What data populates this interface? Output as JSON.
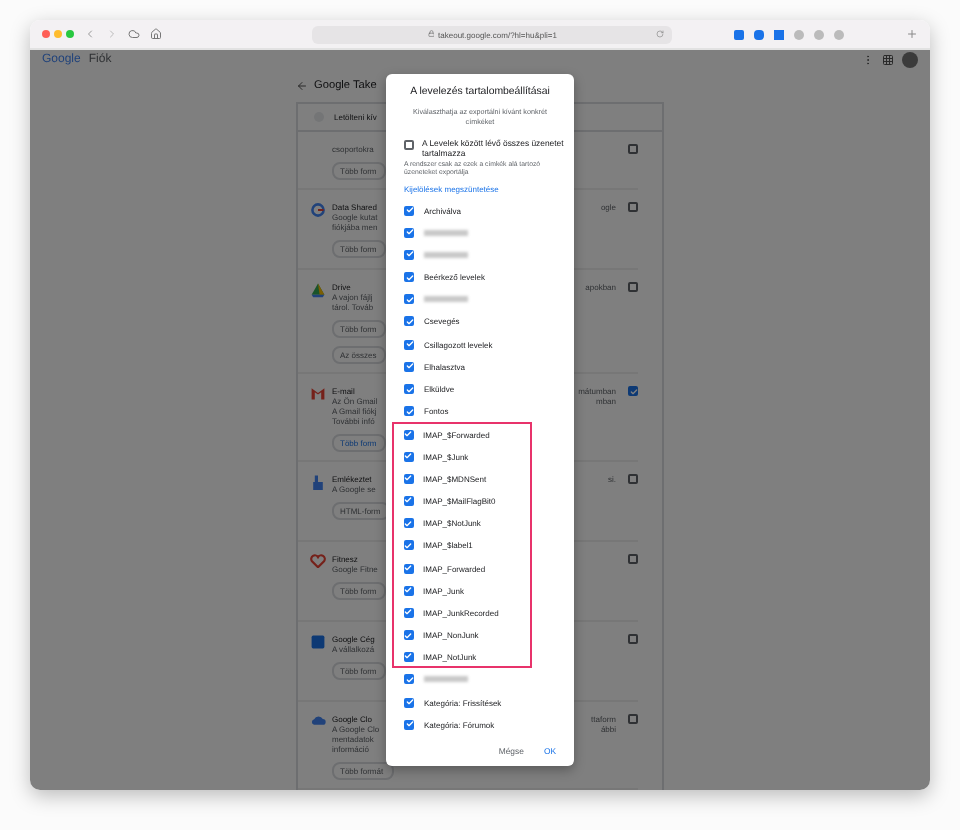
{
  "browser": {
    "url": "takeout.google.com/?hl=hu&pli=1"
  },
  "page": {
    "brand": "Google",
    "product": "Fiók",
    "title": "Google Take",
    "panel_header": "Letölteni kív",
    "services": [
      {
        "lines": [
          "csoportokra"
        ],
        "chip": "Több form",
        "checked": false
      },
      {
        "name": "Data Shared",
        "lines": [
          "Google kutat",
          "fiókjába men"
        ],
        "chip": "Több form",
        "tail": [
          "ogle"
        ],
        "checked": false
      },
      {
        "name": "Drive",
        "lines": [
          "A vajon fájlj",
          "tárol. Továb"
        ],
        "chip": "Több form",
        "chip2": "Az összes",
        "tail": [
          "apokban"
        ],
        "checked": false
      },
      {
        "name": "E-mail",
        "lines": [
          "Az Ön Gmail",
          "A Gmail fiókj",
          "További infó"
        ],
        "chip": "Több form",
        "tail": [
          "mátumban",
          "mban"
        ],
        "checked": true
      },
      {
        "name": "Emlékeztet",
        "lines": [
          "A Google se"
        ],
        "chip": "HTML-form",
        "tail": [
          "si."
        ],
        "checked": false
      },
      {
        "name": "Fitnesz",
        "lines": [
          "Google Fitne"
        ],
        "chip": "Több form",
        "checked": false
      },
      {
        "name": "Google Cég",
        "lines": [
          "A vállalkozá"
        ],
        "chip": "Több form",
        "checked": false
      },
      {
        "name": "Google Clo",
        "lines": [
          "A Google Clo",
          "mentadatok",
          "információ"
        ],
        "chip": "Több formát",
        "tail": [
          "ttaform",
          "ábbi"
        ],
        "checked": false
      }
    ]
  },
  "dialog": {
    "title": "A levelezés tartalombeállításai",
    "subtitle": "Kiválaszthatja az exportálni kívánt konkrét címkéket",
    "include_all": {
      "label": "A Levelek között lévő összes üzenetet tartalmazza",
      "hint": "A rendszer csak az ezek a címkék alá tartozó üzeneteket exportálja",
      "checked": false
    },
    "clear_link": "Kijelölések megszüntetése",
    "labels": [
      {
        "kind": "text",
        "label": "Archiválva",
        "checked": true,
        "highlighted": false
      },
      {
        "kind": "redacted",
        "checked": true,
        "highlighted": false
      },
      {
        "kind": "redacted",
        "checked": true,
        "highlighted": false
      },
      {
        "kind": "text",
        "label": "Beérkező levelek",
        "checked": true,
        "highlighted": false
      },
      {
        "kind": "redacted",
        "checked": true,
        "highlighted": false
      },
      {
        "kind": "text",
        "label": "Csevegés",
        "checked": true,
        "highlighted": false
      },
      {
        "kind": "text",
        "label": "Csillagozott levelek",
        "checked": true,
        "highlighted": false
      },
      {
        "kind": "text",
        "label": "Elhalasztva",
        "checked": true,
        "highlighted": false
      },
      {
        "kind": "text",
        "label": "Elküldve",
        "checked": true,
        "highlighted": false
      },
      {
        "kind": "text",
        "label": "Fontos",
        "checked": true,
        "highlighted": false
      },
      {
        "kind": "text",
        "label": "IMAP_$Forwarded",
        "checked": true,
        "highlighted": true
      },
      {
        "kind": "text",
        "label": "IMAP_$Junk",
        "checked": true,
        "highlighted": true
      },
      {
        "kind": "text",
        "label": "IMAP_$MDNSent",
        "checked": true,
        "highlighted": true
      },
      {
        "kind": "text",
        "label": "IMAP_$MailFlagBit0",
        "checked": true,
        "highlighted": true
      },
      {
        "kind": "text",
        "label": "IMAP_$NotJunk",
        "checked": true,
        "highlighted": true
      },
      {
        "kind": "text",
        "label": "IMAP_$label1",
        "checked": true,
        "highlighted": true
      },
      {
        "kind": "text",
        "label": "IMAP_Forwarded",
        "checked": true,
        "highlighted": true
      },
      {
        "kind": "text",
        "label": "IMAP_Junk",
        "checked": true,
        "highlighted": true
      },
      {
        "kind": "text",
        "label": "IMAP_JunkRecorded",
        "checked": true,
        "highlighted": true
      },
      {
        "kind": "text",
        "label": "IMAP_NonJunk",
        "checked": true,
        "highlighted": true
      },
      {
        "kind": "text",
        "label": "IMAP_NotJunk",
        "checked": true,
        "highlighted": true
      },
      {
        "kind": "redacted",
        "checked": true,
        "highlighted": false
      },
      {
        "kind": "text",
        "label": "Kategória: Frissítések",
        "checked": true,
        "highlighted": false
      },
      {
        "kind": "text",
        "label": "Kategória: Fórumok",
        "checked": true,
        "highlighted": false
      }
    ],
    "buttons": [
      {
        "label": "Mégse",
        "kind": "secondary"
      },
      {
        "label": "OK",
        "kind": "primary"
      }
    ]
  }
}
